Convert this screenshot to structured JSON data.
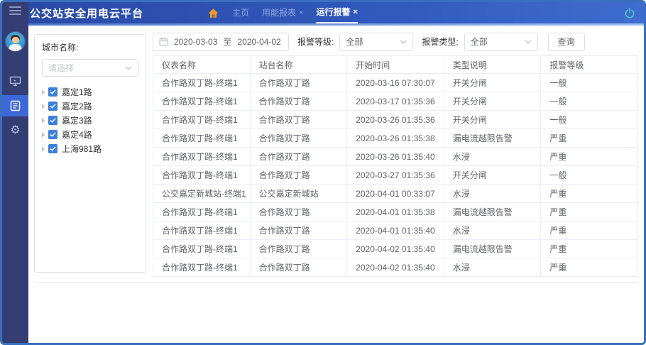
{
  "app": {
    "title": "公交站安全用电云平台"
  },
  "topbar": {
    "tabs": [
      {
        "label": "主页"
      },
      {
        "label": "用能报表",
        "close": "×"
      },
      {
        "label": "运行报警",
        "close": "×"
      }
    ]
  },
  "city_panel": {
    "label": "城市名称:",
    "select_placeholder": "请选择",
    "tree": [
      {
        "label": "嘉定1路",
        "checked": true
      },
      {
        "label": "嘉定2路",
        "checked": true
      },
      {
        "label": "嘉定3路",
        "checked": true
      },
      {
        "label": "嘉定4路",
        "checked": true
      },
      {
        "label": "上海981路",
        "checked": true
      }
    ]
  },
  "filters": {
    "date_start": "2020-03-03",
    "date_separator": "至",
    "date_end": "2020-04-02",
    "alarm_level_label": "报警等级:",
    "alarm_level_value": "全部",
    "alarm_type_label": "报警类型:",
    "alarm_type_value": "全部",
    "query_button": "查询"
  },
  "table": {
    "columns": [
      "仪表名称",
      "站台名称",
      "开始时间",
      "类型说明",
      "报警等级"
    ],
    "rows": [
      [
        "合作路双丁路-终端1",
        "合作路双丁路",
        "2020-03-16 07:30:07",
        "开关分闸",
        "一般"
      ],
      [
        "合作路双丁路-终端1",
        "合作路双丁路",
        "2020-03-17 01:35:36",
        "开关分闸",
        "一般"
      ],
      [
        "合作路双丁路-终端1",
        "合作路双丁路",
        "2020-03-26 01:35:36",
        "开关分闸",
        "一般"
      ],
      [
        "合作路双丁路-终端1",
        "合作路双丁路",
        "2020-03-26 01:35:38",
        "漏电流越限告警",
        "严重"
      ],
      [
        "合作路双丁路-终端1",
        "合作路双丁路",
        "2020-03-26 01:35:40",
        "水浸",
        "严重"
      ],
      [
        "合作路双丁路-终端1",
        "合作路双丁路",
        "2020-03-27 01:35:36",
        "开关分闸",
        "一般"
      ],
      [
        "公交嘉定新城站-终端1",
        "公交嘉定新城站",
        "2020-04-01 00:33:07",
        "水浸",
        "严重"
      ],
      [
        "合作路双丁路-终端1",
        "合作路双丁路",
        "2020-04-01 01:35:38",
        "漏电流越限告警",
        "严重"
      ],
      [
        "合作路双丁路-终端1",
        "合作路双丁路",
        "2020-04-01 01:35:40",
        "水浸",
        "严重"
      ],
      [
        "合作路双丁路-终端1",
        "合作路双丁路",
        "2020-04-02 01:35:40",
        "漏电流越限告警",
        "严重"
      ],
      [
        "合作路双丁路-终端1",
        "合作路双丁路",
        "2020-04-02 01:35:40",
        "水浸",
        "严重"
      ]
    ]
  },
  "icons": {
    "sidebar": [
      "monitor-icon",
      "report-icon",
      "gear-icon"
    ],
    "gear_glyph": "⚙"
  },
  "colors": {
    "topbar_blue": "#3158bc",
    "sidebar_navy": "#343e72",
    "active_nav_blue": "#3d68d8",
    "home_icon_orange": "#f59a23",
    "power_icon_teal": "#4ecdc4",
    "checkbox_blue": "#3e7fd8",
    "frame_border_blue": "#3a6fc0"
  }
}
